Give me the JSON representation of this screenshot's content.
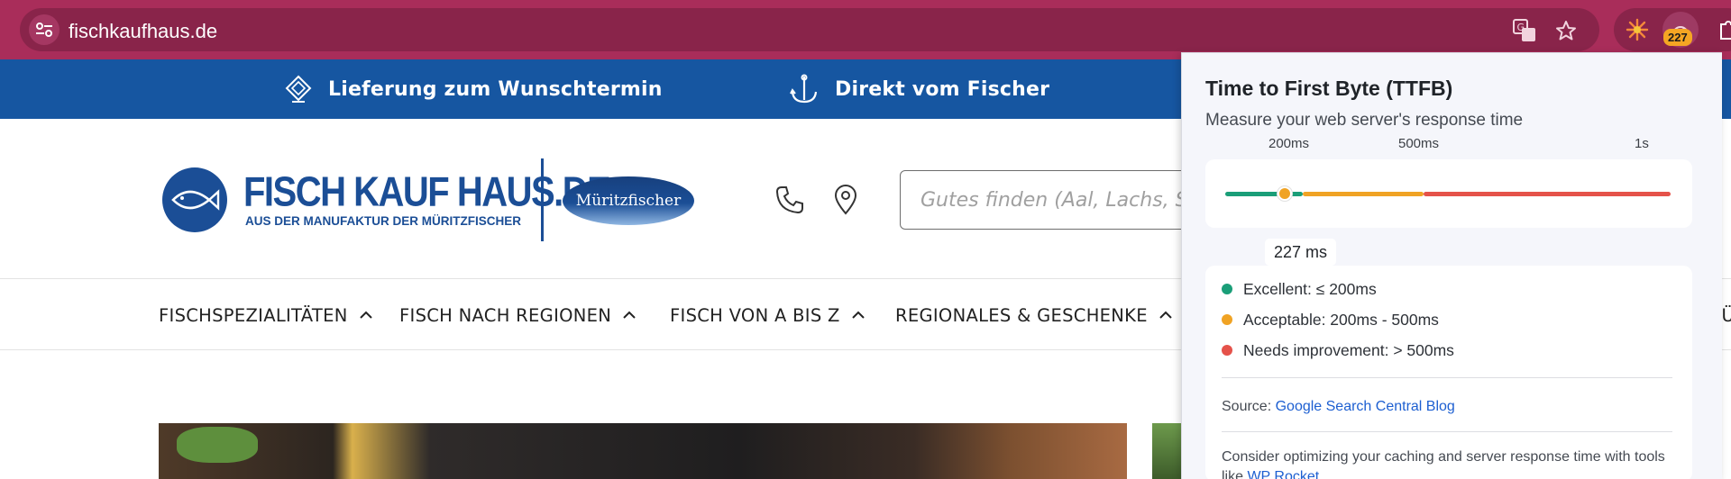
{
  "browser": {
    "url": "fischkaufhaus.de",
    "extension_badge": "227",
    "icons": [
      "site-settings-icon",
      "translate-icon",
      "bookmark-star-icon",
      "extension-sun-icon",
      "extension-speed-icon",
      "puzzle-icon"
    ]
  },
  "promo": {
    "items": [
      {
        "label": "Lieferung zum Wunschtermin",
        "icon": "diamond-calendar-icon"
      },
      {
        "label": "Direkt vom Fischer",
        "icon": "anchor-icon"
      }
    ]
  },
  "header": {
    "logo_name": "FISCH KAUF HAUS.DE",
    "logo_tagline": "AUS DER MANUFAKTUR DER MÜRITZFISCHER",
    "partner_logo": "Müritzfischer",
    "search_placeholder": "Gutes finden (Aal, Lachs, Sup",
    "icons": [
      "phone-icon",
      "location-pin-icon"
    ]
  },
  "nav": {
    "items": [
      {
        "label": "FISCHSPEZIALITÄTEN"
      },
      {
        "label": "FISCH NACH REGIONEN"
      },
      {
        "label": "FISCH VON A BIS Z"
      },
      {
        "label": "REGIONALES & GESCHENKE"
      },
      {
        "label": "FÜ"
      }
    ]
  },
  "popup": {
    "title": "Time to First Byte (TTFB)",
    "subtitle": "Measure your web server's response time",
    "scale_labels": [
      "200ms",
      "500ms",
      "1s"
    ],
    "current_value": "227 ms",
    "current_ms": 227,
    "colors": {
      "excellent": "#1a9e78",
      "acceptable": "#f0a324",
      "needs_improvement": "#e5524a"
    },
    "legend": [
      {
        "label": "Excellent: ≤ 200ms",
        "color": "#1a9e78"
      },
      {
        "label": "Acceptable: 200ms - 500ms",
        "color": "#f0a324"
      },
      {
        "label": "Needs improvement: > 500ms",
        "color": "#e5524a"
      }
    ],
    "source_prefix": "Source: ",
    "source_link": "Google Search Central Blog",
    "advice_text": "Consider optimizing your caching and server response time with tools like ",
    "advice_link": "WP Rocket",
    "advice_suffix": "."
  }
}
